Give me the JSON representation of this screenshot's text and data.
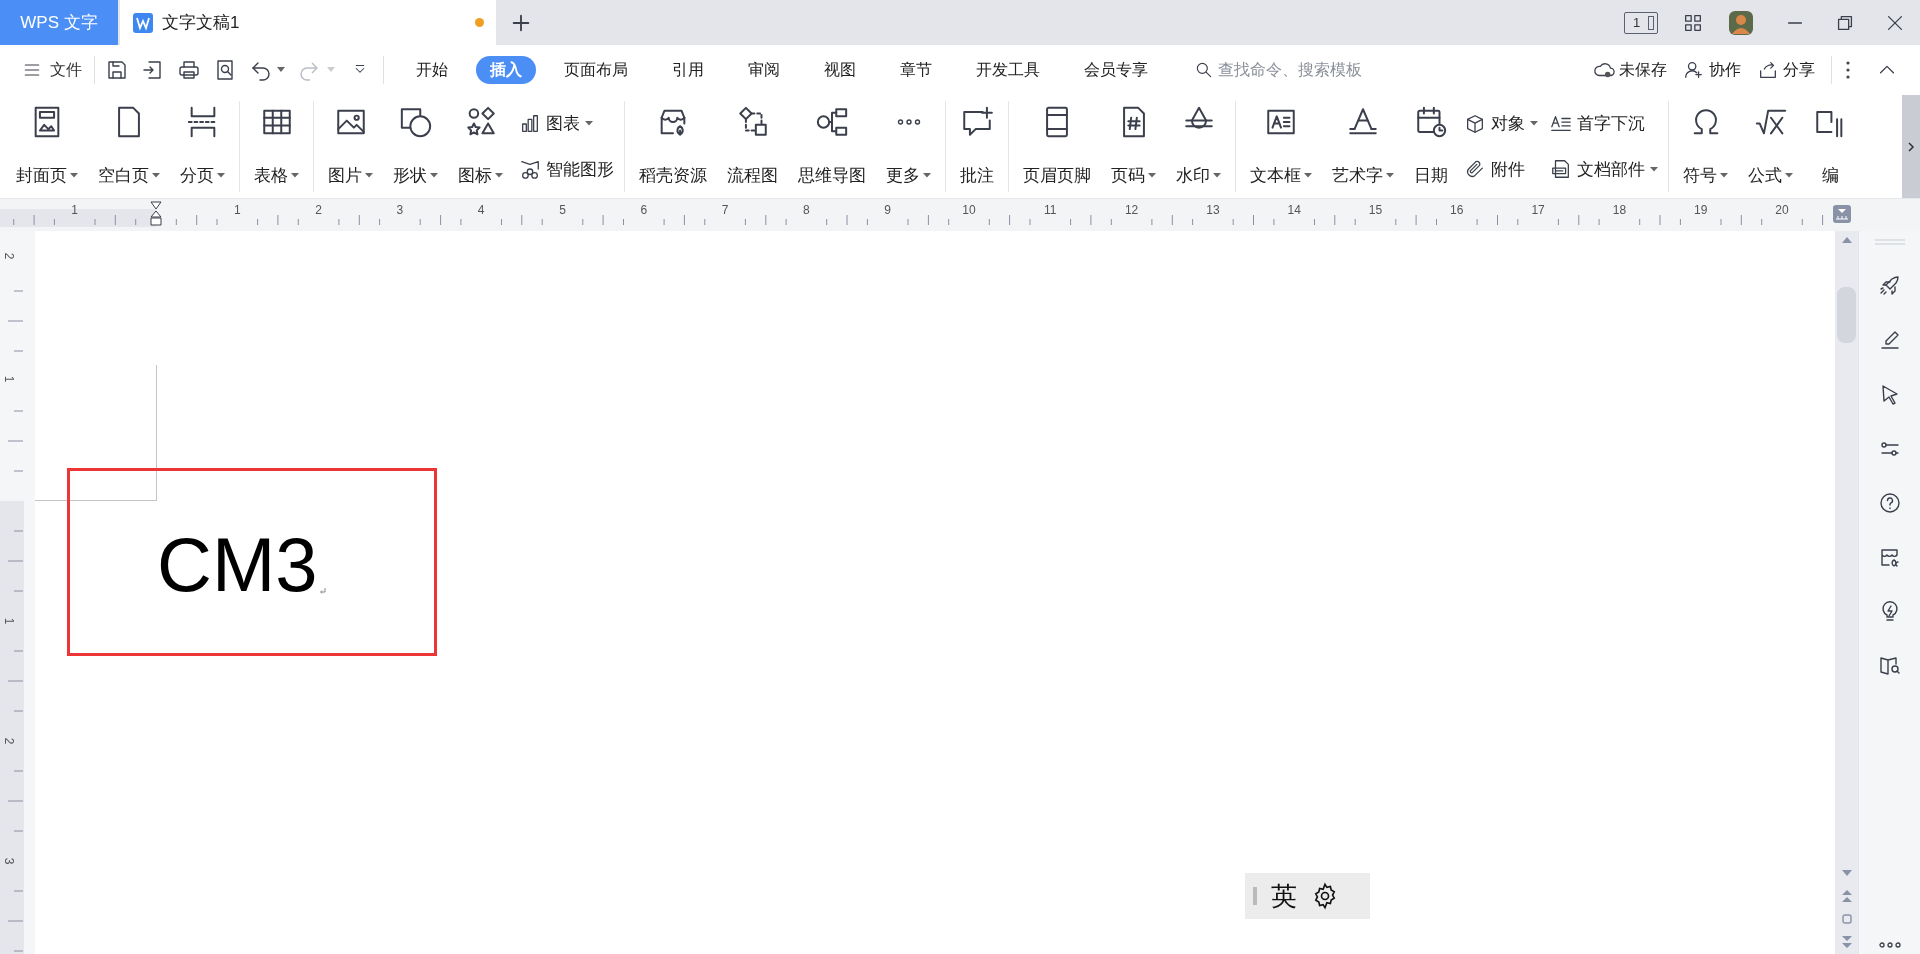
{
  "title_bar": {
    "app_tab": "WPS 文字",
    "document_tab": {
      "title": "文字文稿1",
      "unsaved": true
    },
    "page_indicator": "1"
  },
  "menu_bar": {
    "file": "文件",
    "tabs": [
      {
        "label": "开始",
        "selected": false
      },
      {
        "label": "插入",
        "selected": true
      },
      {
        "label": "页面布局",
        "selected": false
      },
      {
        "label": "引用",
        "selected": false
      },
      {
        "label": "审阅",
        "selected": false
      },
      {
        "label": "视图",
        "selected": false
      },
      {
        "label": "章节",
        "selected": false
      },
      {
        "label": "开发工具",
        "selected": false
      },
      {
        "label": "会员专享",
        "selected": false
      }
    ],
    "search": {
      "placeholder": "查找命令、搜索模板"
    },
    "actions": [
      "未保存",
      "协作",
      "分享"
    ]
  },
  "ribbon": {
    "groups": [
      {
        "items": [
          {
            "kind": "large",
            "label": "封面页",
            "dropdown": true
          },
          {
            "kind": "large",
            "label": "空白页",
            "dropdown": true
          },
          {
            "kind": "large",
            "label": "分页",
            "dropdown": true
          }
        ]
      },
      {
        "items": [
          {
            "kind": "large",
            "label": "表格",
            "dropdown": true
          }
        ]
      },
      {
        "items": [
          {
            "kind": "large",
            "label": "图片",
            "dropdown": true
          },
          {
            "kind": "large",
            "label": "形状",
            "dropdown": true
          },
          {
            "kind": "large",
            "label": "图标",
            "dropdown": true
          },
          {
            "kind": "stack",
            "items": [
              {
                "label": "图表",
                "dropdown": true
              },
              {
                "label": "智能图形",
                "dropdown": false
              }
            ]
          }
        ]
      },
      {
        "items": [
          {
            "kind": "large",
            "label": "稻壳资源",
            "dropdown": false
          },
          {
            "kind": "large",
            "label": "流程图",
            "dropdown": false
          },
          {
            "kind": "large",
            "label": "思维导图",
            "dropdown": false
          },
          {
            "kind": "large",
            "label": "更多",
            "dropdown": true
          }
        ]
      },
      {
        "items": [
          {
            "kind": "large",
            "label": "批注",
            "dropdown": false
          }
        ]
      },
      {
        "items": [
          {
            "kind": "large",
            "label": "页眉页脚",
            "dropdown": false
          },
          {
            "kind": "large",
            "label": "页码",
            "dropdown": true
          },
          {
            "kind": "large",
            "label": "水印",
            "dropdown": true
          }
        ]
      },
      {
        "items": [
          {
            "kind": "large",
            "label": "文本框",
            "dropdown": true
          },
          {
            "kind": "large",
            "label": "艺术字",
            "dropdown": true
          },
          {
            "kind": "large",
            "label": "日期",
            "dropdown": false
          },
          {
            "kind": "stack",
            "items": [
              {
                "label": "对象",
                "dropdown": true
              },
              {
                "label": "附件",
                "dropdown": false
              }
            ]
          },
          {
            "kind": "stack",
            "items": [
              {
                "label": "首字下沉",
                "dropdown": false
              },
              {
                "label": "文档部件",
                "dropdown": true
              }
            ]
          }
        ]
      },
      {
        "items": [
          {
            "kind": "large",
            "label": "符号",
            "dropdown": true
          },
          {
            "kind": "large",
            "label": "公式",
            "dropdown": true
          },
          {
            "kind": "large",
            "label": "编",
            "dropdown": false
          }
        ]
      }
    ]
  },
  "ruler": {
    "top_labels": [
      "1",
      "1",
      "2",
      "3",
      "4",
      "5",
      "6",
      "7",
      "8",
      "9",
      "10",
      "11",
      "12",
      "13",
      "14",
      "15",
      "16",
      "17",
      "18",
      "19",
      "20"
    ],
    "side_labels": [
      "2",
      "1",
      "1",
      "2",
      "3"
    ]
  },
  "document": {
    "text": "CM3"
  },
  "ime_bar": {
    "mode": "英"
  }
}
